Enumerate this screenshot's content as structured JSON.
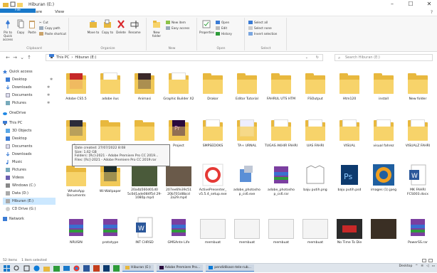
{
  "window": {
    "title": "Hiburan (E:)",
    "controls": [
      "–",
      "☐",
      "✕"
    ]
  },
  "ribbon_tabs": [
    "File",
    "Home",
    "Share",
    "View"
  ],
  "ribbon_groups": {
    "clipboard": {
      "name": "Clipboard",
      "pin": "Pin to Quick access",
      "copy": "Copy",
      "paste": "Paste",
      "cut": "Cut",
      "copy_path": "Copy path",
      "paste_shortcut": "Paste shortcut"
    },
    "organize": {
      "name": "Organize",
      "move_to": "Move to",
      "copy_to": "Copy to",
      "delete": "Delete",
      "rename": "Rename"
    },
    "new": {
      "name": "New",
      "new_folder": "New folder",
      "new_item": "New item",
      "easy_access": "Easy access"
    },
    "open": {
      "name": "Open",
      "properties": "Properties",
      "open": "Open",
      "edit": "Edit",
      "history": "History"
    },
    "select": {
      "name": "Select",
      "select_all": "Select all",
      "select_none": "Select none",
      "invert": "Invert selection"
    }
  },
  "address": {
    "path": [
      "This PC",
      "Hiburan (E:)"
    ],
    "search_placeholder": "Search Hiburan (E:)"
  },
  "nav_items": [
    {
      "label": "Quick access",
      "pinned": false
    },
    {
      "label": "Desktop",
      "pinned": true
    },
    {
      "label": "Downloads",
      "pinned": true
    },
    {
      "label": "Documents",
      "pinned": true
    },
    {
      "label": "Pictures",
      "pinned": true
    },
    {
      "label": "OneDrive",
      "pinned": false
    },
    {
      "label": "This PC",
      "pinned": false
    },
    {
      "label": "3D Objects",
      "pinned": false
    },
    {
      "label": "Desktop",
      "pinned": false
    },
    {
      "label": "Documents",
      "pinned": false
    },
    {
      "label": "Downloads",
      "pinned": false
    },
    {
      "label": "Music",
      "pinned": false
    },
    {
      "label": "Pictures",
      "pinned": false
    },
    {
      "label": "Videos",
      "pinned": false
    },
    {
      "label": "Windows (C:)",
      "pinned": false
    },
    {
      "label": "Data (D:)",
      "pinned": false
    },
    {
      "label": "Hiburan (E:)",
      "pinned": false
    },
    {
      "label": "CD Drive (G:)",
      "pinned": false
    },
    {
      "label": "Network",
      "pinned": false
    }
  ],
  "row1": [
    "Adobe CS5.5",
    "adobe ilus",
    "Animasi",
    "Graphic Builder X2",
    "Drakor",
    "Editor Tutorial",
    "FAHRUL UTS HTM",
    "FSOutput",
    "Htm120",
    "install",
    "New folder"
  ],
  "row2": [
    "Ppt",
    "",
    "",
    "Project",
    "SMPSEDOKS",
    "TA+ URNAL",
    "TUGAS AKHIR FAHRI",
    "UAS FAHRI",
    "VISUAL",
    "visual fahrez",
    "VISUALZ FAHRI"
  ],
  "row3": [
    "WhatsApp Documents",
    "Wi-Wallpaper",
    "20a4b560d01d0 5c0d1ade084f5d 29-1080p.mp4",
    "207ee6fe39c51 20b701d8bcd 2a29.mp4",
    "ActivePresenter_ v5.5.4_setup.exe",
    "adobe_photosho p_cs6.exe",
    "adobe_photosho p_cs6.rar",
    "baju putih.png",
    "baju putih.psd",
    "images (1).jpeg",
    "MK FAHRI FCS003.docx"
  ],
  "row4": [
    "NRUSIN",
    "prototype",
    "INT CHRSD",
    "GMSAnte Life",
    "membuat",
    "membuat",
    "membuat",
    "membuat",
    "No Time To Die",
    "",
    "PowerSS.rar"
  ],
  "tooltip": {
    "line1": "Date created: 27/07/2022 8:08",
    "line2": "Size: 1,62 GB",
    "line3": "Folders: [Rc]-2021 - Adobe Premiere Pro CC 2019...",
    "line4": "Files: [Rc]-2021 - Adobe Premiere Pro CC 2019.rar"
  },
  "status": {
    "count": "52 items",
    "selected": "1 item selected"
  },
  "taskbar": {
    "apps": [
      "Hiburan (E:)",
      "Adobe Premiere Pro...",
      "pendidikasn-tele-rub..."
    ],
    "search": "Desktop",
    "time": "",
    "lang": ""
  },
  "colors": {
    "accent": "#1979ca",
    "folder": "#e8b83e",
    "folder_front": "#f7d36a",
    "selection": "#cce8ff"
  }
}
